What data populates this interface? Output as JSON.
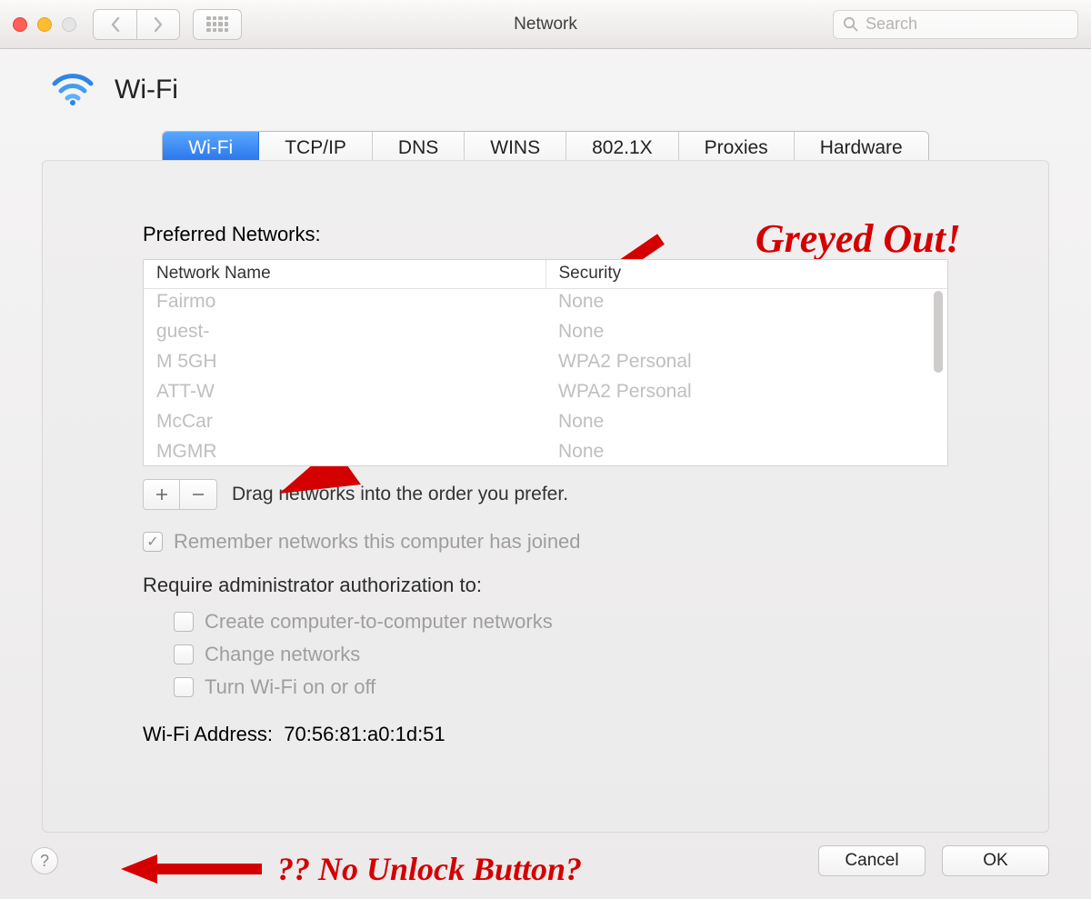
{
  "window": {
    "title": "Network"
  },
  "search": {
    "placeholder": "Search"
  },
  "header": {
    "title": "Wi-Fi"
  },
  "tabs": [
    "Wi-Fi",
    "TCP/IP",
    "DNS",
    "WINS",
    "802.1X",
    "Proxies",
    "Hardware"
  ],
  "preferred_label": "Preferred Networks:",
  "columns": {
    "name": "Network Name",
    "security": "Security"
  },
  "networks": [
    {
      "name": "Fairmo",
      "security": "None"
    },
    {
      "name": "guest-",
      "security": "None"
    },
    {
      "name": "M 5GH",
      "security": "WPA2 Personal"
    },
    {
      "name": "ATT-W",
      "security": "WPA2 Personal"
    },
    {
      "name": "McCar",
      "security": "None"
    },
    {
      "name": "MGMR",
      "security": "None"
    }
  ],
  "drag_hint": "Drag networks into the order you prefer.",
  "remember_label": "Remember networks this computer has joined",
  "require_label": "Require administrator authorization to:",
  "auth_opts": {
    "create": "Create computer-to-computer networks",
    "change": "Change networks",
    "toggle": "Turn Wi-Fi on or off"
  },
  "addr_label": "Wi-Fi Address:",
  "addr_value": "70:56:81:a0:1d:51",
  "buttons": {
    "cancel": "Cancel",
    "ok": "OK"
  },
  "annotations": {
    "greyed": "Greyed Out!",
    "nolock": "?? No Unlock Button?"
  }
}
